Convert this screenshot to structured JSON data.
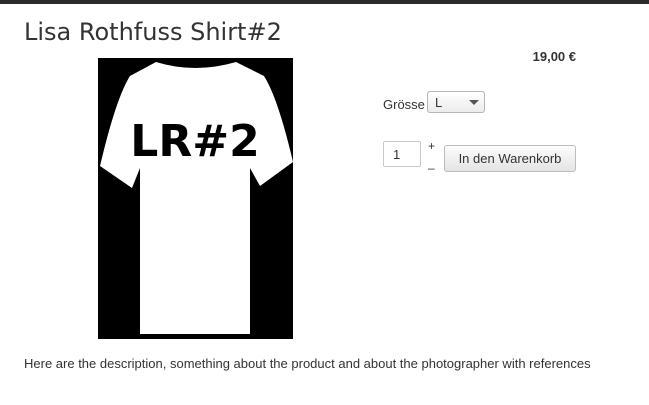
{
  "product": {
    "title": "Lisa Rothfuss Shirt#2",
    "price": "19,00 €",
    "image_text": "LR#2",
    "description": "Here are the description, something about the product and about the photographer with references"
  },
  "options": {
    "size_label": "Grösse",
    "size_value": "L"
  },
  "cart": {
    "quantity": "1",
    "plus_label": "+",
    "minus_label": "–",
    "button_label": "In den Warenkorb"
  }
}
